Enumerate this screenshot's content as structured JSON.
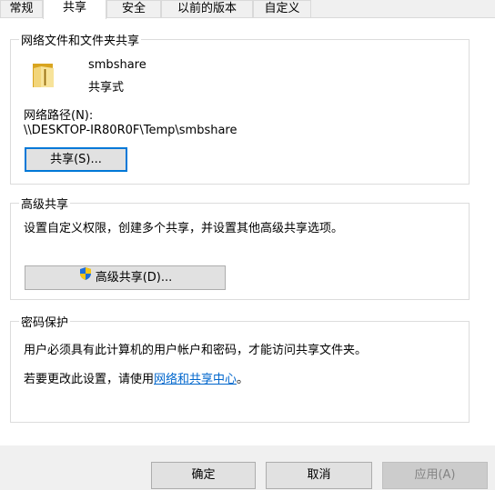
{
  "tabs": [
    {
      "label": "常规"
    },
    {
      "label": "共享"
    },
    {
      "label": "安全"
    },
    {
      "label": "以前的版本"
    },
    {
      "label": "自定义"
    }
  ],
  "network_sharing": {
    "title": "网络文件和文件夹共享",
    "folder_name": "smbshare",
    "share_status": "共享式",
    "path_label": "网络路径(N):",
    "path_value": "\\\\DESKTOP-IR80R0F\\Temp\\smbshare",
    "share_button": "共享(S)..."
  },
  "advanced_sharing": {
    "title": "高级共享",
    "description": "设置自定义权限，创建多个共享，并设置其他高级共享选项。",
    "button": "高级共享(D)..."
  },
  "password_protection": {
    "title": "密码保护",
    "description": "用户必须具有此计算机的用户帐户和密码，才能访问共享文件夹。",
    "change_prefix": "若要更改此设置，请使用",
    "link": "网络和共享中心",
    "change_suffix": "。"
  },
  "footer": {
    "ok": "确定",
    "cancel": "取消",
    "apply": "应用(A)"
  },
  "colors": {
    "accent": "#0078d7",
    "link": "#0066cc",
    "folder": "#e8c35a"
  }
}
